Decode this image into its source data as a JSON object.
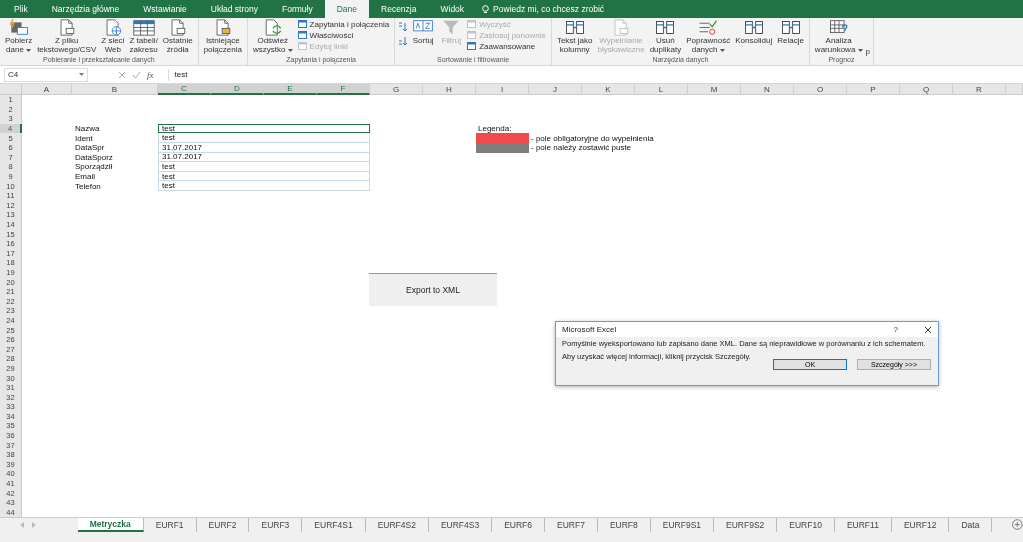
{
  "menu_tabs": [
    {
      "label": "Plik",
      "selected": false
    },
    {
      "label": "Narzędzia główne",
      "selected": false
    },
    {
      "label": "Wstawianie",
      "selected": false
    },
    {
      "label": "Układ strony",
      "selected": false
    },
    {
      "label": "Formuły",
      "selected": false
    },
    {
      "label": "Dane",
      "selected": true
    },
    {
      "label": "Recenzja",
      "selected": false
    },
    {
      "label": "Widok",
      "selected": false
    }
  ],
  "tell_me": "Powiedz mi, co chcesz zrobić",
  "ribbon_groups": [
    {
      "label": "Pobieranie i przekształcanie danych",
      "commands": [
        {
          "kind": "large",
          "lines": [
            "Pobierz",
            "dane"
          ],
          "dropdown": true,
          "disabled": false
        },
        {
          "kind": "large",
          "lines": [
            "Z pliku",
            "tekstowego/CSV"
          ],
          "dropdown": false,
          "disabled": false
        },
        {
          "kind": "large",
          "lines": [
            "Z sieci",
            "Web"
          ],
          "dropdown": false,
          "disabled": false
        },
        {
          "kind": "large",
          "lines": [
            "Z tabeli/",
            "zakresu"
          ],
          "dropdown": false,
          "disabled": false
        },
        {
          "kind": "large",
          "lines": [
            "Ostatnie",
            "źródła"
          ],
          "dropdown": false,
          "disabled": false
        }
      ]
    },
    {
      "commands": [
        {
          "kind": "large",
          "lines": [
            "Istniejące",
            "połączenia"
          ],
          "dropdown": false,
          "disabled": false
        }
      ]
    },
    {
      "label": "Zapytania i połączenia",
      "commands": [
        {
          "kind": "large",
          "lines": [
            "Odśwież",
            "wszystko"
          ],
          "dropdown": true,
          "disabled": false
        },
        {
          "kind": "stack",
          "items": [
            {
              "label": "Zapytania i połączenia",
              "disabled": false
            },
            {
              "label": "Właściwości",
              "disabled": false
            },
            {
              "label": "Edytuj linki",
              "disabled": true
            }
          ]
        }
      ]
    },
    {
      "label": "Sortowanie i filtrowanie",
      "commands": [
        {
          "kind": "sortpair"
        },
        {
          "kind": "large",
          "lines": [
            "Sortuj"
          ],
          "dropdown": false,
          "disabled": false
        },
        {
          "kind": "large",
          "lines": [
            "Filtruj"
          ],
          "dropdown": false,
          "disabled": true
        },
        {
          "kind": "stack",
          "items": [
            {
              "label": "Wyczyść",
              "disabled": true
            },
            {
              "label": "Zastosuj ponownie",
              "disabled": true
            },
            {
              "label": "Zaawansowane",
              "disabled": false
            }
          ]
        }
      ]
    },
    {
      "label": "Narzędzia danych",
      "commands": [
        {
          "kind": "large",
          "lines": [
            "Tekst jako",
            "kolumny"
          ],
          "dropdown": false,
          "disabled": false
        },
        {
          "kind": "large",
          "lines": [
            "Wypełnianie",
            "błyskawiczne"
          ],
          "dropdown": false,
          "disabled": true
        },
        {
          "kind": "large",
          "lines": [
            "Usuń",
            "duplikaty"
          ],
          "dropdown": false,
          "disabled": false
        },
        {
          "kind": "large",
          "lines": [
            "Poprawność",
            "danych"
          ],
          "dropdown": true,
          "disabled": false
        },
        {
          "kind": "large",
          "lines": [
            "Konsoliduj"
          ],
          "dropdown": false,
          "disabled": false
        },
        {
          "kind": "large",
          "lines": [
            "Relacje"
          ],
          "dropdown": false,
          "disabled": false
        }
      ]
    },
    {
      "label": "Prognoz",
      "commands": [
        {
          "kind": "large",
          "lines": [
            "Analiza",
            "warunkowa"
          ],
          "dropdown": true,
          "disabled": false,
          "cut_tail": "p"
        }
      ]
    }
  ],
  "formula_bar": {
    "name_box": "C4",
    "function_label": "fx",
    "value": "test"
  },
  "columns": [
    {
      "label": "A",
      "selected": false
    },
    {
      "label": "B",
      "selected": false
    },
    {
      "label": "C",
      "selected": true
    },
    {
      "label": "D",
      "selected": true
    },
    {
      "label": "E",
      "selected": true
    },
    {
      "label": "F",
      "selected": true
    },
    {
      "label": "G",
      "selected": false
    },
    {
      "label": "H",
      "selected": false
    },
    {
      "label": "I",
      "selected": false
    },
    {
      "label": "J",
      "selected": false
    },
    {
      "label": "K",
      "selected": false
    },
    {
      "label": "L",
      "selected": false
    },
    {
      "label": "M",
      "selected": false
    },
    {
      "label": "N",
      "selected": false
    },
    {
      "label": "O",
      "selected": false
    },
    {
      "label": "P",
      "selected": false
    },
    {
      "label": "Q",
      "selected": false
    },
    {
      "label": "R",
      "selected": false
    }
  ],
  "rows": [
    {
      "label": "1",
      "selected": false
    },
    {
      "label": "2",
      "selected": false
    },
    {
      "label": "3",
      "selected": false
    },
    {
      "label": "4",
      "selected": true
    },
    {
      "label": "5",
      "selected": false
    },
    {
      "label": "6",
      "selected": false
    },
    {
      "label": "7",
      "selected": false
    },
    {
      "label": "8",
      "selected": false
    },
    {
      "label": "9",
      "selected": false
    },
    {
      "label": "10",
      "selected": false
    },
    {
      "label": "11",
      "selected": false
    },
    {
      "label": "12",
      "selected": false
    },
    {
      "label": "13",
      "selected": false
    },
    {
      "label": "14",
      "selected": false
    },
    {
      "label": "15",
      "selected": false
    },
    {
      "label": "16",
      "selected": false
    },
    {
      "label": "17",
      "selected": false
    },
    {
      "label": "18",
      "selected": false
    },
    {
      "label": "19",
      "selected": false
    },
    {
      "label": "20",
      "selected": false
    },
    {
      "label": "21",
      "selected": false
    },
    {
      "label": "22",
      "selected": false
    },
    {
      "label": "23",
      "selected": false
    },
    {
      "label": "24",
      "selected": false
    },
    {
      "label": "25",
      "selected": false
    },
    {
      "label": "26",
      "selected": false
    },
    {
      "label": "27",
      "selected": false
    },
    {
      "label": "28",
      "selected": false
    },
    {
      "label": "29",
      "selected": false
    },
    {
      "label": "30",
      "selected": false
    },
    {
      "label": "31",
      "selected": false
    },
    {
      "label": "32",
      "selected": false
    },
    {
      "label": "33",
      "selected": false
    },
    {
      "label": "34",
      "selected": false
    },
    {
      "label": "35",
      "selected": false
    },
    {
      "label": "36",
      "selected": false
    },
    {
      "label": "37",
      "selected": false
    },
    {
      "label": "38",
      "selected": false
    },
    {
      "label": "39",
      "selected": false
    },
    {
      "label": "40",
      "selected": false
    },
    {
      "label": "41",
      "selected": false
    },
    {
      "label": "42",
      "selected": false
    },
    {
      "label": "43",
      "selected": false
    },
    {
      "label": "44",
      "selected": false
    }
  ],
  "fields": [
    {
      "label": "Nazwa",
      "value": "test",
      "selected": true
    },
    {
      "label": "Ident",
      "value": "test",
      "selected": false
    },
    {
      "label": "DataSpr",
      "value": "31.07.2017",
      "selected": false
    },
    {
      "label": "DataSporz",
      "value": "31.07.2017",
      "selected": false
    },
    {
      "label": "Sporządził",
      "value": "test",
      "selected": false
    },
    {
      "label": "Email",
      "value": "test",
      "selected": false
    },
    {
      "label": "Telefon",
      "value": "test",
      "selected": false
    }
  ],
  "legend": {
    "title": "Legenda:",
    "items": [
      {
        "color": "#f04a4a",
        "text": "- pole obligatoryjne do wypełnienia"
      },
      {
        "color": "#7f7f7f",
        "text": "- pole należy zostawić puste"
      }
    ]
  },
  "export_button": "Export to XML",
  "dialog": {
    "title": "Microsoft Excel",
    "help": "?",
    "message": "Pomyślnie wyeksportowano lub zapisano dane XML. Dane są nieprawidłowe w porównaniu z ich schematem.",
    "info": "Aby uzyskać więcej informacji, kliknij przycisk Szczegóły.",
    "buttons": [
      {
        "label": "OK",
        "default": true
      },
      {
        "label": "Szczegóły >>>",
        "default": false
      }
    ]
  },
  "sheet_tabs": [
    {
      "label": "Metryczka",
      "selected": true
    },
    {
      "label": "EURF1",
      "selected": false
    },
    {
      "label": "EURF2",
      "selected": false
    },
    {
      "label": "EURF3",
      "selected": false
    },
    {
      "label": "EURF4S1",
      "selected": false
    },
    {
      "label": "EURF4S2",
      "selected": false
    },
    {
      "label": "EURF4S3",
      "selected": false
    },
    {
      "label": "EURF6",
      "selected": false
    },
    {
      "label": "EURF7",
      "selected": false
    },
    {
      "label": "EURF8",
      "selected": false
    },
    {
      "label": "EURF9S1",
      "selected": false
    },
    {
      "label": "EURF9S2",
      "selected": false
    },
    {
      "label": "EURF10",
      "selected": false
    },
    {
      "label": "EURF11",
      "selected": false
    },
    {
      "label": "EURF12",
      "selected": false
    },
    {
      "label": "Data",
      "selected": false
    }
  ]
}
